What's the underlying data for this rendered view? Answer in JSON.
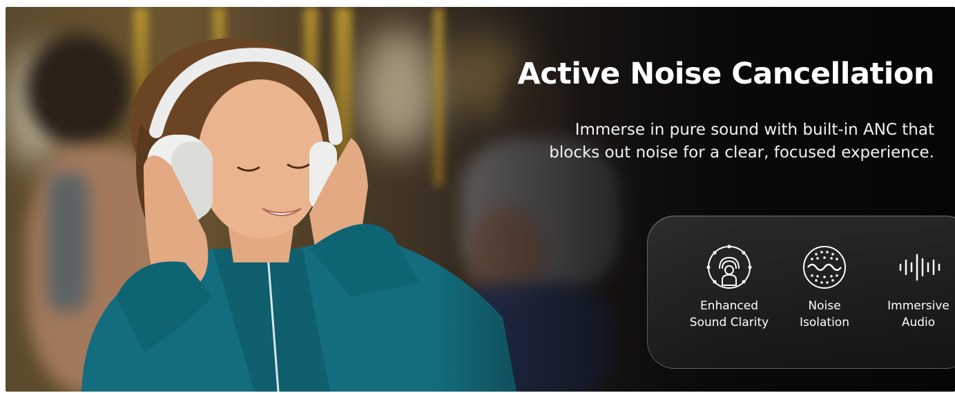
{
  "banner": {
    "headline": "Active Noise Cancellation",
    "subtext": "Immerse in pure sound with built-in ANC that blocks out noise for a clear, focused experience.",
    "features": [
      {
        "icon": "sound-clarity-icon",
        "label": "Enhanced\nSound Clarity"
      },
      {
        "icon": "noise-isolation-icon",
        "label": "Noise\nIsolation"
      },
      {
        "icon": "immersive-audio-icon",
        "label": "Immersive\nAudio"
      }
    ],
    "photo": "woman-wearing-headphones-on-bus"
  }
}
